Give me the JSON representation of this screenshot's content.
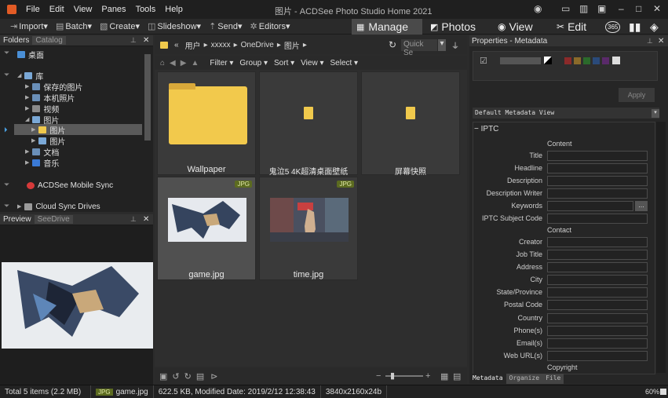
{
  "window": {
    "title": "图片 - ACDSee Photo Studio Home 2021",
    "menu": [
      "File",
      "Edit",
      "View",
      "Panes",
      "Tools",
      "Help"
    ]
  },
  "toolbar": {
    "import": "Import",
    "batch": "Batch",
    "create": "Create",
    "slideshow": "Slideshow",
    "send": "Send",
    "editors": "Editors"
  },
  "modes": {
    "manage": "Manage",
    "photos": "Photos",
    "view": "View",
    "edit": "Edit",
    "dashboard": "365"
  },
  "folders_panel": {
    "tabs": [
      "Folders",
      "Catalog"
    ],
    "items": [
      "桌面",
      "库",
      "保存的图片",
      "本机照片",
      "视频",
      "图片",
      "图片",
      "图片",
      "文档",
      "音乐",
      "ACDSee Mobile Sync",
      "Cloud Sync Drives"
    ]
  },
  "preview_panel": {
    "tabs": [
      "Preview",
      "SeeDrive"
    ]
  },
  "address": {
    "path": [
      "«",
      "用户",
      "xxxxx",
      "OneDrive",
      "图片"
    ],
    "quick_search": "Quick Se"
  },
  "filterbar": {
    "filter": "Filter",
    "group": "Group",
    "sort": "Sort",
    "view": "View",
    "select": "Select"
  },
  "files": [
    {
      "name": "Wallpaper",
      "type": "folder",
      "badge": ""
    },
    {
      "name": "鬼泣5 4K超清桌面壁纸",
      "type": "folder",
      "badge": ""
    },
    {
      "name": "屏幕快照",
      "type": "folder",
      "badge": ""
    },
    {
      "name": "game.jpg",
      "type": "image",
      "badge": "JPG"
    },
    {
      "name": "time.jpg",
      "type": "image",
      "badge": "JPG"
    }
  ],
  "properties": {
    "title": "Properties - Metadata",
    "apply": "Apply",
    "view_select": "Default Metadata View",
    "section": "IPTC",
    "group_content": "Content",
    "group_contact": "Contact",
    "fields_content": [
      "Title",
      "Headline",
      "Description",
      "Description Writer",
      "Keywords",
      "IPTC Subject Code"
    ],
    "fields_contact": [
      "Creator",
      "Job Title",
      "Address",
      "City",
      "State/Province",
      "Postal Code",
      "Country",
      "Phone(s)",
      "Email(s)",
      "Web URL(s)"
    ],
    "copyright": "Copyright",
    "ellipsis": "...",
    "label_colors": [
      "#8b2a2a",
      "#8a6a2a",
      "#2b6a2b",
      "#2a4a7a",
      "#5a2a6a"
    ],
    "tabs": [
      "Metadata",
      "Organize",
      "File"
    ]
  },
  "status": {
    "total": "Total 5 items  (2.2 MB)",
    "file_badge": "JPG",
    "file_name": "game.jpg",
    "info": "622.5 KB, Modified Date: 2019/2/12 12:38:43",
    "dimensions": "3840x2160x24b",
    "zoom": "60%"
  }
}
